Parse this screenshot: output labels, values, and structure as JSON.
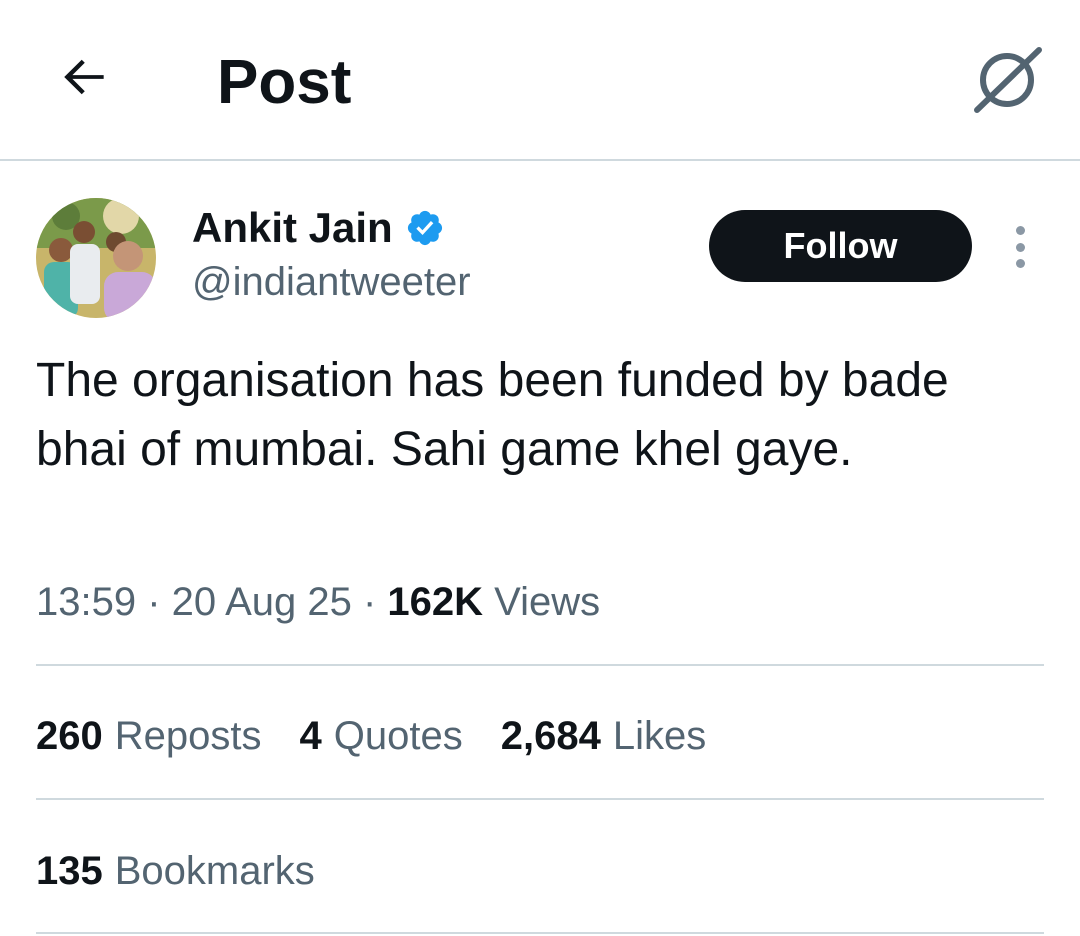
{
  "header": {
    "back_icon": "arrow-left-icon",
    "title": "Post",
    "grok_icon": "grok-icon"
  },
  "author": {
    "display_name": "Ankit Jain",
    "handle": "@indiantweeter",
    "verified": true,
    "verified_color": "#1d9bf0"
  },
  "follow_button": {
    "label": "Follow"
  },
  "post": {
    "text": "The organisation has been funded by bade bhai of mumbai. Sahi game khel gaye.",
    "time": "13:59",
    "date": "20 Aug 25",
    "views_count": "162K",
    "views_label": "Views"
  },
  "stats": {
    "reposts": {
      "count": "260",
      "label": "Reposts"
    },
    "quotes": {
      "count": "4",
      "label": "Quotes"
    },
    "likes": {
      "count": "2,684",
      "label": "Likes"
    },
    "bookmarks": {
      "count": "135",
      "label": "Bookmarks"
    }
  },
  "colors": {
    "text_primary": "#0f1419",
    "text_secondary": "#536471",
    "divider": "#cfd9de",
    "follow_bg": "#0f1419"
  }
}
